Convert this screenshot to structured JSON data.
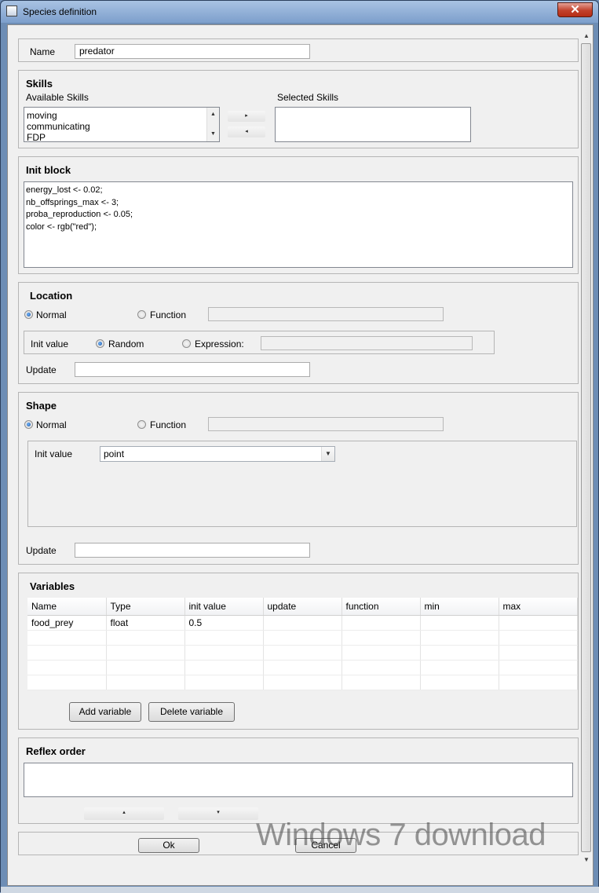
{
  "window": {
    "title": "Species definition",
    "close_label": "✕"
  },
  "name_row": {
    "label": "Name",
    "value": "predator"
  },
  "skills": {
    "heading": "Skills",
    "available_label": "Available Skills",
    "selected_label": "Selected Skills",
    "available_items": [
      "moving",
      "communicating",
      "FDP"
    ],
    "selected_items": [],
    "add_label": "▸",
    "remove_label": "◂"
  },
  "init_block": {
    "heading": "Init block",
    "lines": [
      "energy_lost <- 0.02;",
      "nb_offsprings_max <- 3;",
      "proba_reproduction <- 0.05;",
      "color <- rgb(\"red\");"
    ]
  },
  "location": {
    "heading": "Location",
    "normal_label": "Normal",
    "function_label": "Function",
    "function_value": "",
    "init_value_label": "Init value",
    "random_label": "Random",
    "expression_label": "Expression:",
    "expression_value": "",
    "update_label": "Update",
    "update_value": "",
    "mode": "Normal",
    "init_mode": "Random"
  },
  "shape": {
    "heading": "Shape",
    "normal_label": "Normal",
    "function_label": "Function",
    "function_value": "",
    "init_value_label": "Init value",
    "init_value_selected": "point",
    "update_label": "Update",
    "update_value": "",
    "mode": "Normal"
  },
  "variables": {
    "heading": "Variables",
    "columns": [
      "Name",
      "Type",
      "init value",
      "update",
      "function",
      "min",
      "max"
    ],
    "rows": [
      [
        "food_prey",
        "float",
        "0.5",
        "",
        "",
        "",
        ""
      ],
      [
        "",
        "",
        "",
        "",
        "",
        "",
        ""
      ],
      [
        "",
        "",
        "",
        "",
        "",
        "",
        ""
      ],
      [
        "",
        "",
        "",
        "",
        "",
        "",
        ""
      ],
      [
        "",
        "",
        "",
        "",
        "",
        "",
        ""
      ]
    ],
    "add_label": "Add variable",
    "delete_label": "Delete variable"
  },
  "reflex_order": {
    "heading": "Reflex order",
    "up_label": "▴",
    "down_label": "▾"
  },
  "footer": {
    "ok_label": "Ok",
    "cancel_label": "Cancel"
  },
  "watermark": {
    "text": "Windows 7 download"
  },
  "colors": {
    "title_bar": "#8fb0d8",
    "close_button": "#c2412c",
    "dialog_bg": "#f0f0f0",
    "radio_selected": "#1a4e9a"
  }
}
